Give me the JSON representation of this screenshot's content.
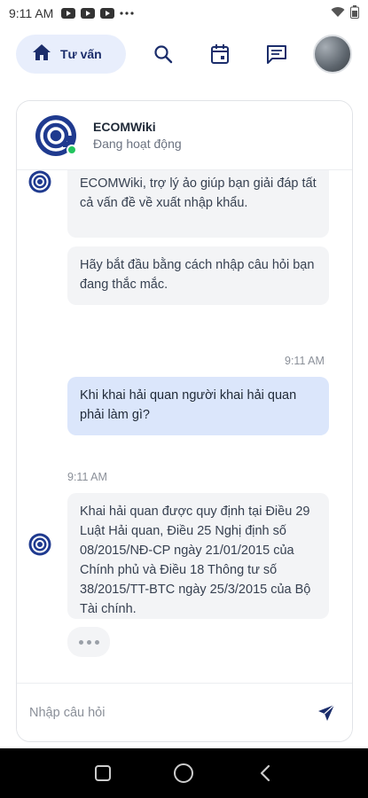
{
  "status_bar": {
    "time": "9:11 AM"
  },
  "nav": {
    "active_tab_label": "Tư vấn"
  },
  "chat": {
    "bot_name": "ECOMWiki",
    "bot_status": "Đang hoạt động",
    "messages": [
      {
        "sender": "bot",
        "text": "ECOMWiki, trợ lý ảo giúp bạn giải đáp tất cả vấn đề về xuất nhập khẩu."
      },
      {
        "sender": "bot",
        "text": "Hãy bắt đầu bằng cách nhập câu hỏi bạn đang thắc mắc."
      },
      {
        "sender": "user",
        "time": "9:11 AM",
        "text": "Khi khai hải quan người khai hải quan phải làm gì?"
      },
      {
        "sender": "bot",
        "time": "9:11 AM",
        "text": "Khai hải quan được quy định tại Điều 29 Luật Hải quan, Điều 25 Nghị định số 08/2015/NĐ-CP ngày 21/01/2015 của Chính phủ và Điều 18 Thông tư số 38/2015/TT-BTC ngày 25/3/2015 của Bộ Tài chính."
      }
    ],
    "input_placeholder": "Nhập câu hỏi"
  },
  "colors": {
    "accent": "#1b2d6b",
    "pill_bg": "#e8eefc",
    "user_bubble": "#dbe6fb",
    "online": "#22c55e"
  }
}
